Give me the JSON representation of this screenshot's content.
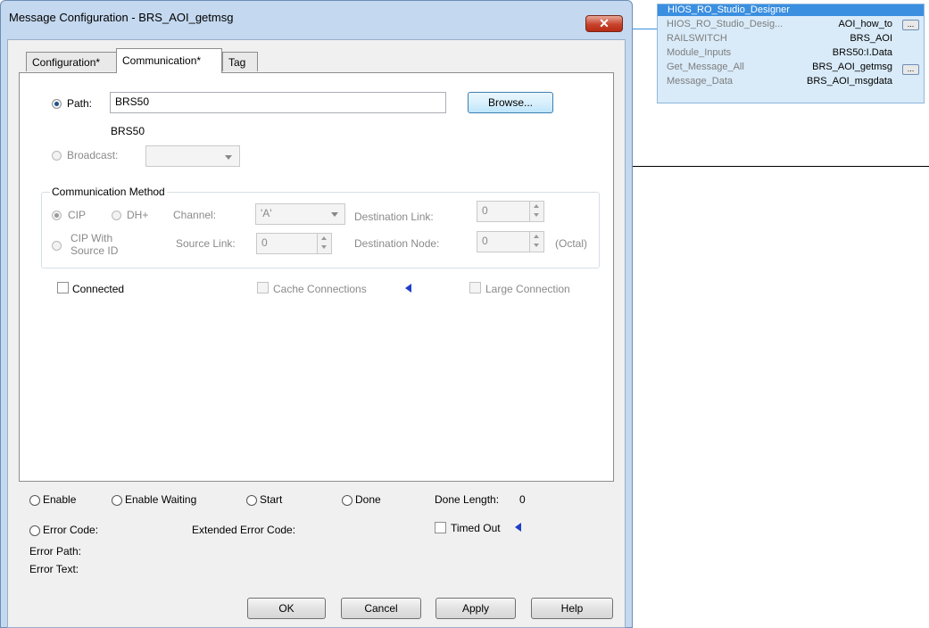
{
  "window": {
    "title": "Message Configuration - BRS_AOI_getmsg",
    "close_symbol": "✕"
  },
  "tabs": [
    {
      "label": "Configuration*"
    },
    {
      "label": "Communication*"
    },
    {
      "label": "Tag"
    }
  ],
  "communication": {
    "path_label": "Path:",
    "path_value": "BRS50",
    "path_resolved": "BRS50",
    "browse_label": "Browse...",
    "broadcast_label": "Broadcast:",
    "broadcast_value": "",
    "method": {
      "legend": "Communication Method",
      "cip_label": "CIP",
      "dh_label": "DH+",
      "channel_label": "Channel:",
      "channel_value": "'A'",
      "dest_link_label": "Destination Link:",
      "dest_link_value": "0",
      "cip_source_label_1": "CIP With",
      "cip_source_label_2": "Source ID",
      "source_link_label": "Source Link:",
      "source_link_value": "0",
      "dest_node_label": "Destination Node:",
      "dest_node_value": "0",
      "octal_label": "(Octal)"
    },
    "connected_label": "Connected",
    "cache_label": "Cache Connections",
    "large_label": "Large Connection"
  },
  "status": {
    "enable": "Enable",
    "enable_waiting": "Enable Waiting",
    "start": "Start",
    "done": "Done",
    "done_length_label": "Done Length:",
    "done_length_value": "0",
    "error_code": "Error Code:",
    "extended_error_code": "Extended Error Code:",
    "timed_out": "Timed Out",
    "error_path": "Error Path:",
    "error_text": "Error Text:"
  },
  "buttons": {
    "ok": "OK",
    "cancel": "Cancel",
    "apply": "Apply",
    "help": "Help"
  },
  "tagbox": {
    "header": "HIOS_RO_Studio_Designer",
    "ellipsis": "...",
    "rows": [
      {
        "name": "HIOS_RO_Studio_Desig...",
        "value": "AOI_how_to"
      },
      {
        "name": "RAILSWITCH",
        "value": "BRS_AOI"
      },
      {
        "name": "Module_Inputs",
        "value": "BRS50:I.Data"
      },
      {
        "name": "Get_Message_All",
        "value": "BRS_AOI_getmsg"
      },
      {
        "name": "Message_Data",
        "value": "BRS_AOI_msgdata"
      }
    ]
  },
  "colors": {
    "accent": "#3a8fe0",
    "arrow": "#1f3ec7",
    "close": "#c7432c"
  }
}
